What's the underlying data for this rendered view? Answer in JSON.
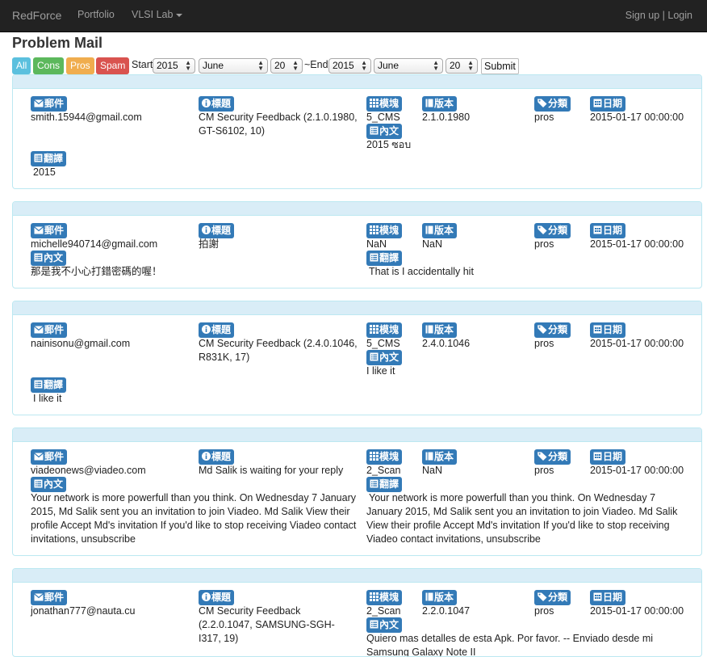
{
  "nav": {
    "brand": "RedForce",
    "portfolio": "Portfolio",
    "vlsi": "VLSI Lab",
    "signup": "Sign up",
    "sep": " | ",
    "login": "Login"
  },
  "page": {
    "title": "Problem Mail"
  },
  "filter": {
    "btn_all": "All",
    "btn_cons": "Cons",
    "btn_pros": "Pros",
    "btn_spam": "Spam",
    "start_label": "Start",
    "end_label": "~End",
    "start_year": "2015",
    "start_month": "June",
    "start_day": "20",
    "end_year": "2015",
    "end_month": "June",
    "end_day": "20",
    "submit": "Submit"
  },
  "labels": {
    "mail": "郵件",
    "title": "標題",
    "module": "模塊",
    "version": "版本",
    "category": "分類",
    "date": "日期",
    "content": "內文",
    "translation": "翻譯"
  },
  "colors": {
    "all": "#5bc0de",
    "cons": "#5cb85c",
    "pros": "#f0ad4e",
    "spam": "#d9534f",
    "label": "#337ab7",
    "panel_head": "#d9edf7"
  },
  "entries": [
    {
      "email": "smith.15944@gmail.com",
      "title": "CM Security Feedback (2.1.0.1980, GT-S6102, 10)",
      "module": "5_CMS",
      "version": "2.1.0.1980",
      "category": "pros",
      "date": "2015-01-17 00:00:00",
      "content": "2015 ซอบ",
      "translation": "2015"
    },
    {
      "email": "michelle940714@gmail.com",
      "title": "拍謝",
      "module": "NaN",
      "version": "NaN",
      "category": "pros",
      "date": "2015-01-17 00:00:00",
      "content": "那是我不小心打錯密碼的喔！",
      "translation": "That is I accidentally hit"
    },
    {
      "email": "nainisonu@gmail.com",
      "title": "CM Security Feedback (2.4.0.1046, R831K, 17)",
      "module": "5_CMS",
      "version": "2.4.0.1046",
      "category": "pros",
      "date": "2015-01-17 00:00:00",
      "content": "I like it",
      "translation": "I like it"
    },
    {
      "email": "viadeonews@viadeo.com",
      "title": "Md Salik is waiting for your reply",
      "module": "2_Scan",
      "version": "NaN",
      "category": "pros",
      "date": "2015-01-17 00:00:00",
      "content": "Your network is more powerfull than you think. On Wednesday 7 January 2015, Md Salik sent you an invitation to join Viadeo. Md Salik View their profile Accept Md's invitation If you'd like to stop receiving Viadeo contact invitations, unsubscribe",
      "translation": "Your network is more powerfull than you think. On Wednesday 7 January 2015, Md Salik sent you an invitation to join Viadeo. Md Salik View their profile Accept Md's invitation If you'd like to stop receiving Viadeo contact invitations, unsubscribe"
    },
    {
      "email": "jonathan777@nauta.cu",
      "title": "CM Security Feedback (2.2.0.1047, SAMSUNG-SGH-I317, 19)",
      "module": "2_Scan",
      "version": "2.2.0.1047",
      "category": "pros",
      "date": "2015-01-17 00:00:00",
      "content": "Quiero mas detalles de esta Apk. Por favor. -- Enviado desde mi Samsung Galaxy Note II"
    }
  ]
}
